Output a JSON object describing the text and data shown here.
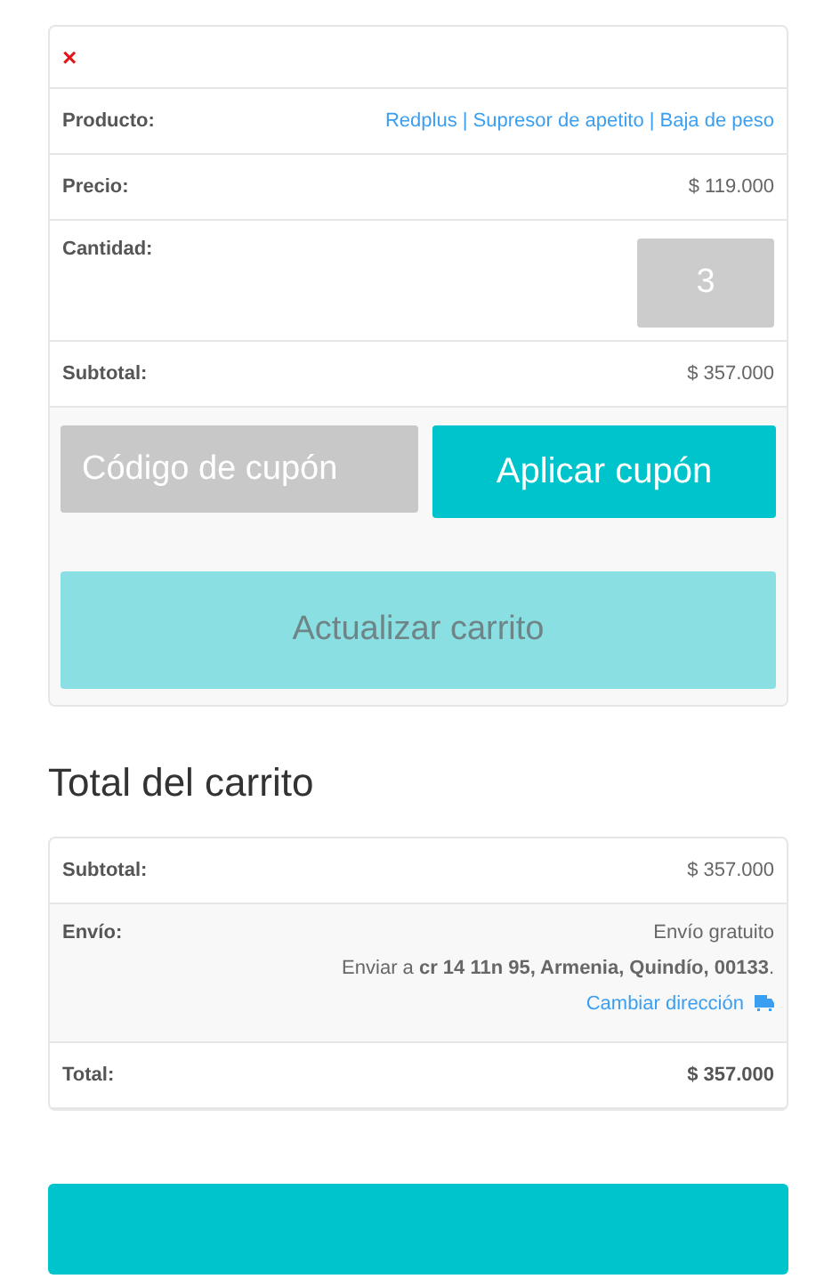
{
  "cart_item": {
    "remove": "×",
    "rows": [
      {
        "kind": "link",
        "label": "Producto:",
        "value": "Redplus | Supresor de apetito | Baja de peso"
      },
      {
        "kind": "text",
        "label": "Precio:",
        "value": "$ 119.000"
      },
      {
        "kind": "quantity",
        "label": "Cantidad:",
        "value": "3"
      },
      {
        "kind": "text",
        "label": "Subtotal:",
        "value": "$ 357.000"
      }
    ]
  },
  "coupon": {
    "placeholder": "Código de cupón",
    "apply_button": "Aplicar cupón"
  },
  "update_button": {
    "label": "Actualizar carrito",
    "disabled": true
  },
  "totals": {
    "title": "Total del carrito",
    "subtotal": {
      "label": "Subtotal:",
      "value": "$ 357.000"
    },
    "shipping": {
      "label": "Envío:",
      "method": "Envío gratuito",
      "destination": "Enviar a **cr 14 11n 95, Armenia, Quindío, 00133**.",
      "change_link": "Cambiar dirección"
    },
    "total": {
      "label": "Total:",
      "value": "$ 357.000"
    }
  }
}
